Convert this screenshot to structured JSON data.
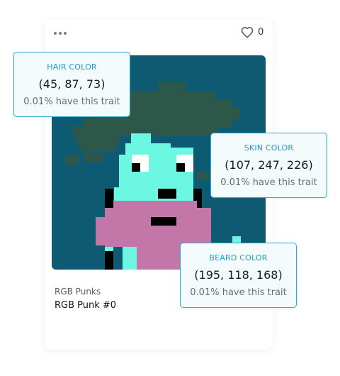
{
  "card": {
    "more_icon": "ellipsis-icon",
    "like_icon": "heart-icon",
    "likes": "0",
    "collection": "RGB Punks",
    "name": "RGB Punk #0"
  },
  "artwork": {
    "background_color": "#0e5a73",
    "hair_color": "#2d5749",
    "skin_color": "#6bf7e2",
    "beard_color": "#c376a8",
    "outline_color": "#000000"
  },
  "traits": [
    {
      "title": "HAIR COLOR",
      "value": "(45, 87, 73)",
      "rarity": "0.01% have this trait"
    },
    {
      "title": "SKIN COLOR",
      "value": "(107, 247, 226)",
      "rarity": "0.01% have this trait"
    },
    {
      "title": "BEARD COLOR",
      "value": "(195, 118, 168)",
      "rarity": "0.01% have this trait"
    }
  ]
}
